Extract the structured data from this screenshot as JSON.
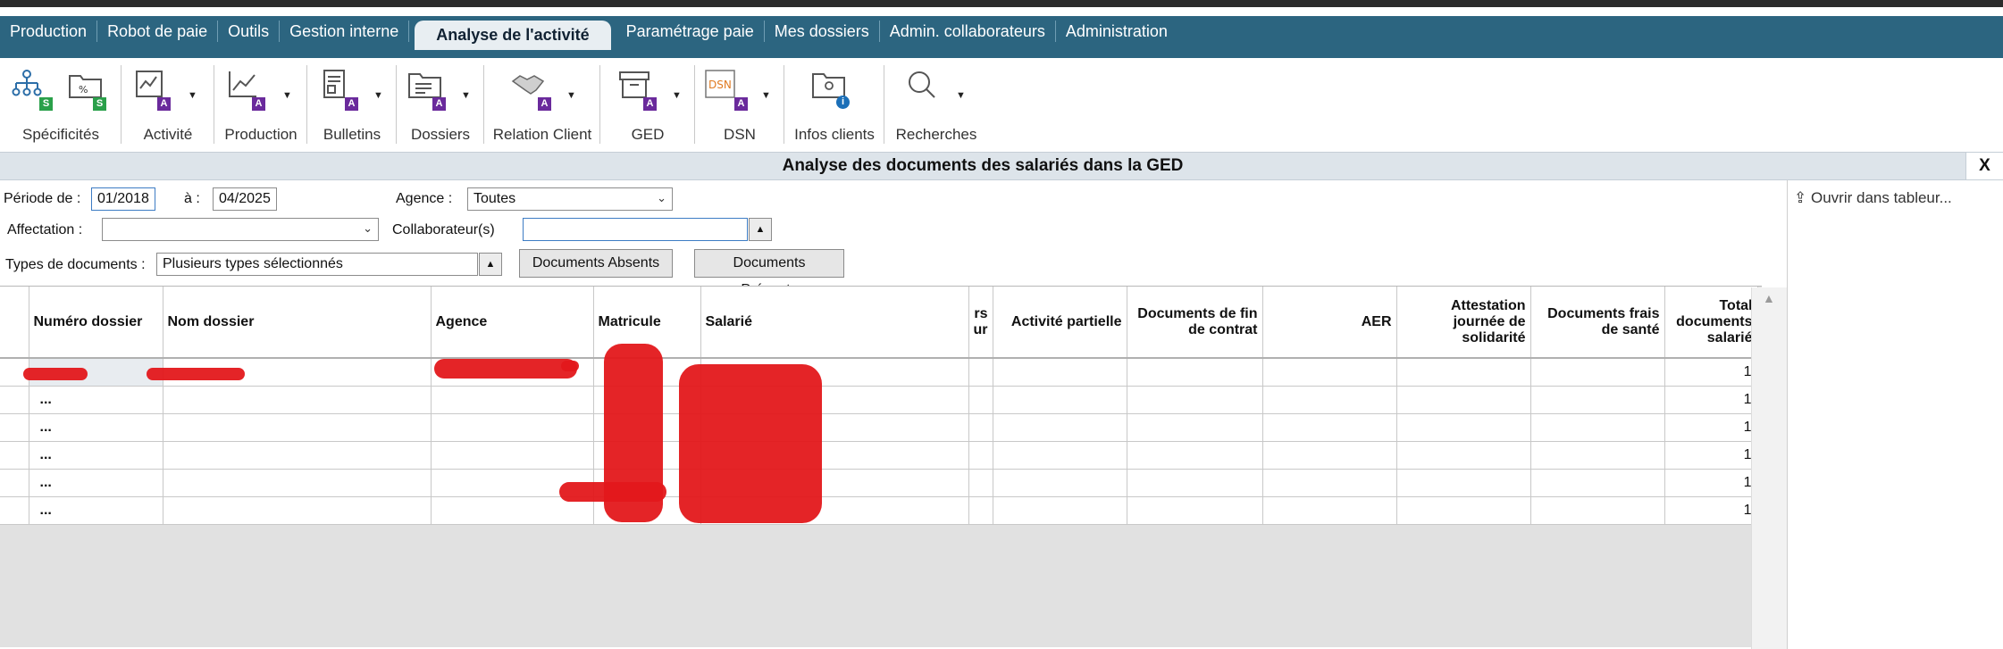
{
  "menu": {
    "items": [
      "Production",
      "Robot de paie",
      "Outils",
      "Gestion interne",
      "Analyse de l'activité",
      "Paramétrage paie",
      "Mes dossiers",
      "Admin. collaborateurs",
      "Administration"
    ],
    "active": "Analyse de l'activité"
  },
  "ribbon": {
    "groups": [
      {
        "label": "Spécificités",
        "icon": "org-chart-icon"
      },
      {
        "label": "Activité",
        "icon": "activity-icon"
      },
      {
        "label": "Production",
        "icon": "chart-line-icon"
      },
      {
        "label": "Bulletins",
        "icon": "payslip-icon"
      },
      {
        "label": "Dossiers",
        "icon": "folder-list-icon"
      },
      {
        "label": "Relation Client",
        "icon": "handshake-icon"
      },
      {
        "label": "GED",
        "icon": "archive-box-icon"
      },
      {
        "label": "DSN",
        "icon": "dsn-icon"
      },
      {
        "label": "Infos clients",
        "icon": "client-info-icon"
      },
      {
        "label": "Recherches",
        "icon": "search-icon"
      }
    ],
    "badge_s": "S",
    "badge_a": "A",
    "badge_i": "i",
    "dsn_text": "DSN"
  },
  "panel": {
    "title": "Analyse des documents des salariés dans la GED",
    "close_label": "X"
  },
  "filters": {
    "periode_label": "Période de :",
    "periode_from": "01/2018",
    "periode_to_label": "à :",
    "periode_to": "04/2025",
    "agence_label": "Agence :",
    "agence_value": "Toutes",
    "affectation_label": "Affectation :",
    "affectation_value": "",
    "collaborateur_label": "Collaborateur(s)",
    "collaborateur_value": "",
    "types_label": "Types de documents :",
    "types_value": "Plusieurs types sélectionnés",
    "btn_absents": "Documents Absents",
    "btn_presents": "Documents Présents"
  },
  "side": {
    "open_label": "Ouvrir dans tableur..."
  },
  "table": {
    "headers": {
      "numero": "Numéro dossier",
      "nom": "Nom dossier",
      "agence": "Agence",
      "matricule": "Matricule",
      "salarie": "Salarié",
      "partial_top": "rs",
      "partial_bottom": "ur",
      "activite": "Activité partielle",
      "fin_contrat": "Documents de fin de contrat",
      "aer": "AER",
      "attestation": "Attestation journée de solidarité",
      "frais_sante": "Documents frais de santé",
      "total": "Total documents salarié"
    },
    "rows": [
      {
        "numero": "",
        "total": "1"
      },
      {
        "numero": "...",
        "total": "1"
      },
      {
        "numero": "...",
        "total": "1"
      },
      {
        "numero": "...",
        "total": "1"
      },
      {
        "numero": "...",
        "total": "1"
      },
      {
        "numero": "...",
        "total": "1"
      }
    ]
  },
  "colors": {
    "menubar": "#2c6580",
    "redaction": "#e3181b",
    "badge_s": "#2aa04a",
    "badge_a": "#6a2a9c"
  }
}
